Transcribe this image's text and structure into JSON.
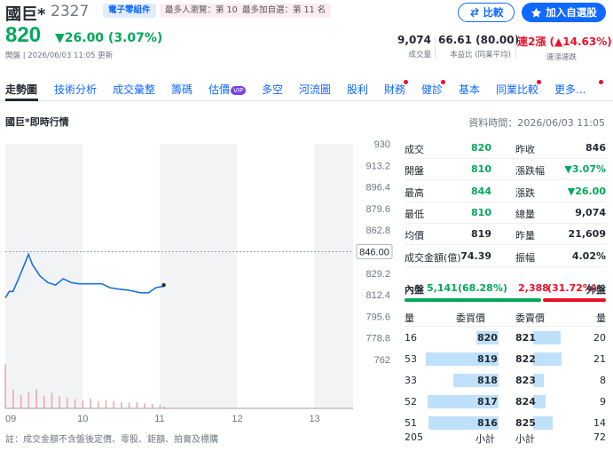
{
  "stock": {
    "name": "國巨*",
    "code": "2327",
    "category": "電子零組件",
    "rank_popular": "最多人瀏覽：第 10 名",
    "rank_watch": "最多加自選：第 11 名",
    "price": "820",
    "change": "▼26.00 (3.07%)",
    "updated": "開盤 | 2026/06/03 11:05 更新",
    "color_down": "#00a85a",
    "color_up": "#eb0f29"
  },
  "buttons": {
    "compare": "比較",
    "watchlist": "加入自選股"
  },
  "stats": {
    "volume_value": "9,074",
    "volume_label": "成交量",
    "ratio_value": "66.61 (80.00)",
    "ratio_label": "本益比 (同業平均)",
    "streak_value": "連2漲 (▲14.63%)",
    "streak_label": "連漲連跌"
  },
  "tabs": [
    "走勢圖",
    "技術分析",
    "成交彙整",
    "籌碼",
    "估價",
    "多空",
    "河流圖",
    "股利",
    "財務",
    "健診",
    "基本",
    "同業比較",
    "更多..."
  ],
  "vip_label": "VIP",
  "section": {
    "title": "國巨*即時行情",
    "time": "資料時間：2026/06/03 11:05"
  },
  "note": "註：成交金額不含盤後定價、零股、鉅額、拍賣及標購",
  "quote": [
    {
      "l": "成交",
      "v": "820",
      "l2": "昨收",
      "v2": "846"
    },
    {
      "l": "開盤",
      "v": "810",
      "l2": "漲跌幅",
      "v2": "▼3.07%"
    },
    {
      "l": "最高",
      "v": "844",
      "l2": "漲跌",
      "v2": "▼26.00"
    },
    {
      "l": "最低",
      "v": "810",
      "l2": "總量",
      "v2": "9,074"
    },
    {
      "l": "均價",
      "v": "819",
      "l2": "昨量",
      "v2": "21,609"
    },
    {
      "l": "成交金額(億)",
      "v": "74.39",
      "l2": "振幅",
      "v2": "4.02%"
    }
  ],
  "inout": {
    "in_label": "內盤",
    "in_value": "5,141",
    "in_pct": "(68.28%)",
    "out_value": "2,388",
    "out_pct": "(31.72%)",
    "out_label": "外盤",
    "in_fraction": 0.6828
  },
  "orderbook": {
    "head": [
      "量",
      "委買價",
      "委賣價",
      "量"
    ],
    "rows": [
      {
        "bq": "16",
        "bp": "820",
        "ap": "821",
        "aq": "20"
      },
      {
        "bq": "53",
        "bp": "819",
        "ap": "822",
        "aq": "21"
      },
      {
        "bq": "33",
        "bp": "818",
        "ap": "823",
        "aq": "8"
      },
      {
        "bq": "52",
        "bp": "817",
        "ap": "824",
        "aq": "9"
      },
      {
        "bq": "51",
        "bp": "816",
        "ap": "825",
        "aq": "14"
      }
    ],
    "foot": {
      "bid_total": "205",
      "bid_label": "小計",
      "ask_label": "小計",
      "ask_total": "72"
    }
  },
  "chart_data": {
    "type": "line",
    "title": "",
    "x_ticks": [
      "09",
      "10",
      "11",
      "12",
      "13"
    ],
    "y_ticks": [
      930.0,
      913.2,
      896.4,
      879.6,
      862.8,
      846.0,
      829.2,
      812.4,
      795.6,
      778.8,
      762.0
    ],
    "ylim": [
      762,
      930
    ],
    "xlim_hours": [
      9,
      13.5
    ],
    "prev_close": 846.0,
    "prev_close_label": "846.00",
    "series": [
      {
        "x": [
          9.0,
          9.05,
          9.1,
          9.2,
          9.3,
          9.35,
          9.45,
          9.55,
          9.65,
          9.75,
          9.85,
          9.95,
          10.05,
          10.15,
          10.25,
          10.35,
          10.45,
          10.6,
          10.75,
          10.85,
          10.95,
          11.05
        ],
        "y": [
          810,
          815,
          815,
          829,
          844,
          836,
          827,
          822,
          820,
          825,
          822,
          821,
          821,
          821,
          821,
          818,
          817,
          816,
          814,
          814,
          818,
          819
        ]
      }
    ],
    "volume_x": [
      9.0,
      9.1,
      9.2,
      9.3,
      9.4,
      9.5,
      9.6,
      9.7,
      9.8,
      9.9,
      10.0,
      10.1,
      10.2,
      10.3,
      10.4,
      10.5,
      10.6,
      10.7,
      10.8,
      10.9,
      11.0,
      11.05
    ],
    "volume_y": [
      620,
      260,
      190,
      230,
      270,
      180,
      220,
      170,
      150,
      130,
      110,
      140,
      100,
      120,
      100,
      90,
      80,
      90,
      70,
      60,
      50,
      25
    ],
    "last_point": {
      "x": 11.05,
      "y": 820
    }
  }
}
